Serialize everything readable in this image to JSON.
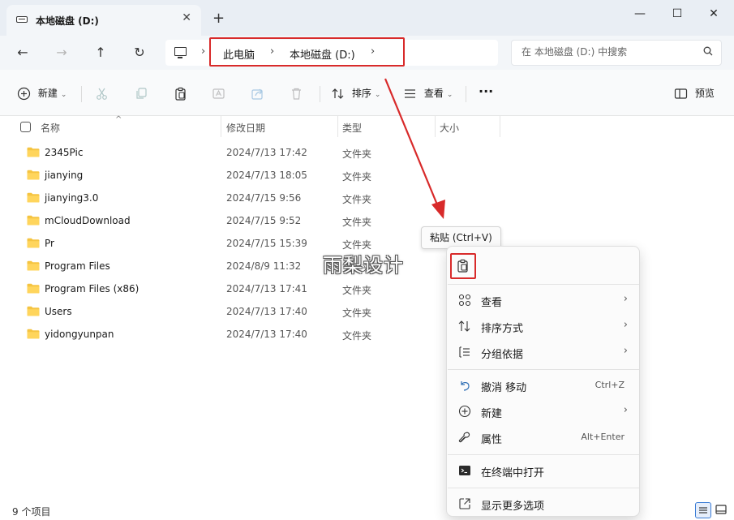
{
  "window": {
    "tab_title": "本地磁盘 (D:)",
    "close_tab": "✕",
    "new_tab": "+",
    "minimize": "—",
    "maximize": "☐",
    "close": "✕"
  },
  "nav": {
    "back": "←",
    "forward": "→",
    "up": "↑",
    "refresh": "↻",
    "breadcrumb": [
      "此电脑",
      "本地磁盘 (D:)"
    ],
    "sep": "›"
  },
  "search": {
    "placeholder": "在 本地磁盘 (D:) 中搜索"
  },
  "toolbar": {
    "new_label": "新建",
    "sort_label": "排序",
    "view_label": "查看",
    "more_label": "···",
    "preview_label": "预览",
    "caret": "⌄"
  },
  "columns": {
    "name": "名称",
    "modified": "修改日期",
    "type": "类型",
    "size": "大小",
    "sort_caret": "^"
  },
  "files": [
    {
      "name": "2345Pic",
      "date": "2024/7/13 17:42",
      "type": "文件夹"
    },
    {
      "name": "jianying",
      "date": "2024/7/13 18:05",
      "type": "文件夹"
    },
    {
      "name": "jianying3.0",
      "date": "2024/7/15 9:56",
      "type": "文件夹"
    },
    {
      "name": "mCloudDownload",
      "date": "2024/7/15 9:52",
      "type": "文件夹"
    },
    {
      "name": "Pr",
      "date": "2024/7/15 15:39",
      "type": "文件夹"
    },
    {
      "name": "Program Files",
      "date": "2024/8/9 11:32",
      "type": "文件夹"
    },
    {
      "name": "Program Files (x86)",
      "date": "2024/7/13 17:41",
      "type": "文件夹"
    },
    {
      "name": "Users",
      "date": "2024/7/13 17:40",
      "type": "文件夹"
    },
    {
      "name": "yidongyunpan",
      "date": "2024/7/13 17:40",
      "type": "文件夹"
    }
  ],
  "status": {
    "count": "9 个项目"
  },
  "watermark": "雨梨设计",
  "tooltip": "粘贴 (Ctrl+V)",
  "context_menu": {
    "items": [
      {
        "label": "查看",
        "chevron": "›"
      },
      {
        "label": "排序方式",
        "chevron": "›"
      },
      {
        "label": "分组依据",
        "chevron": "›"
      },
      {
        "label": "撤消 移动",
        "shortcut": "Ctrl+Z"
      },
      {
        "label": "新建",
        "chevron": "›"
      },
      {
        "label": "属性",
        "shortcut": "Alt+Enter"
      },
      {
        "label": "在终端中打开"
      },
      {
        "label": "显示更多选项"
      }
    ]
  },
  "colors": {
    "highlight_red": "#d82a2a",
    "folder_yellow": "#f5c441",
    "accent_blue": "#3a7bd5"
  }
}
